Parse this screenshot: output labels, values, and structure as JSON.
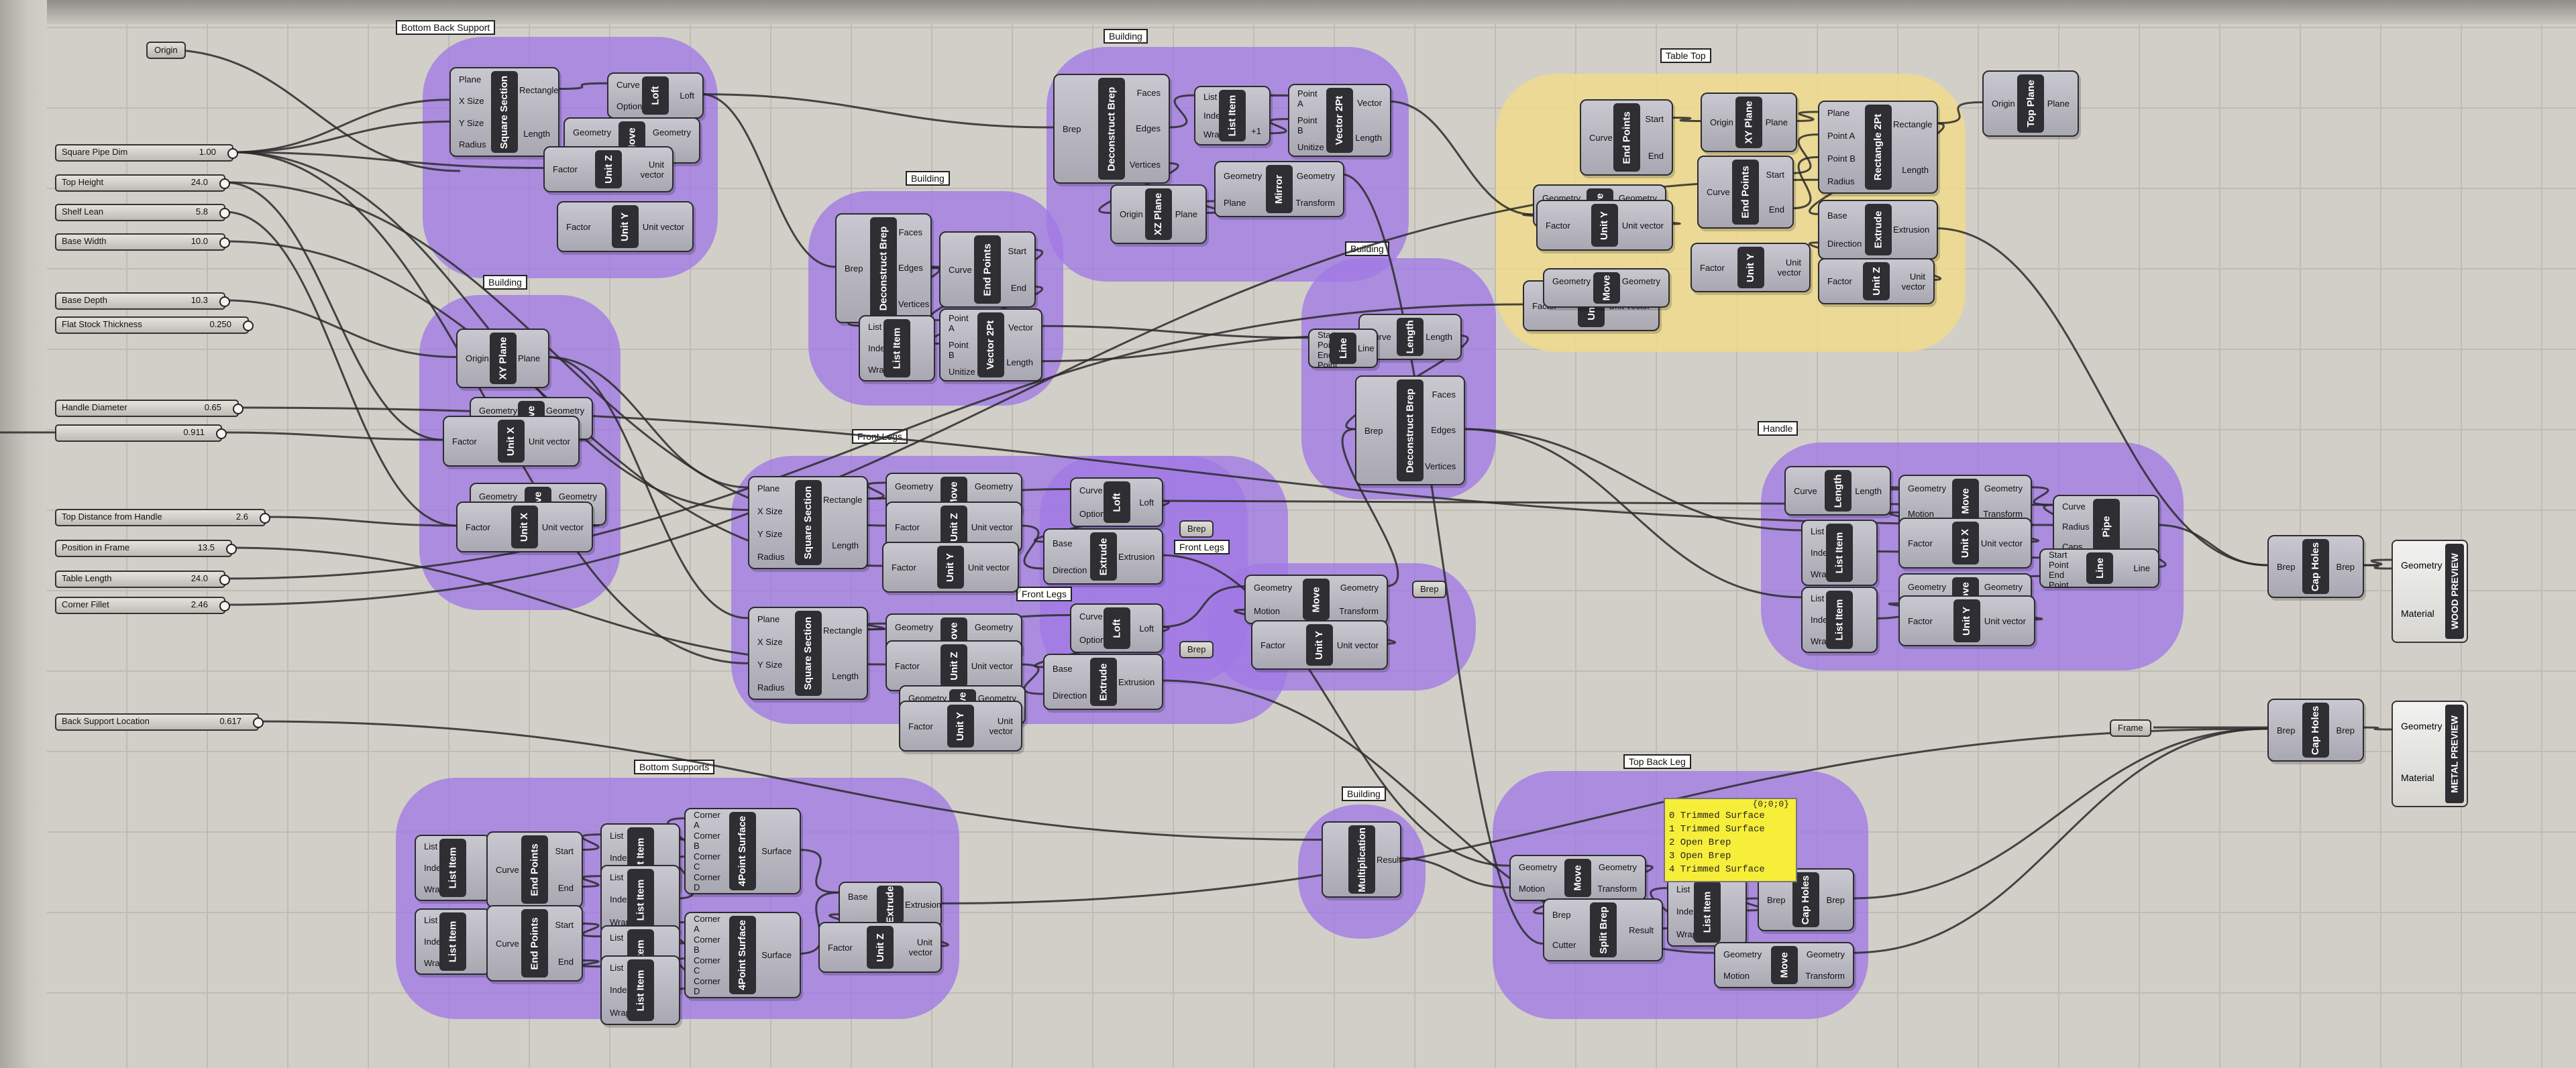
{
  "app": {
    "name": "Grasshopper canvas"
  },
  "groups": [
    {
      "id": "bottom-back-support",
      "label": "Bottom Back Support",
      "color": "purple"
    },
    {
      "id": "building-1",
      "label": "Building",
      "color": "purple"
    },
    {
      "id": "building-2",
      "label": "Building",
      "color": "purple"
    },
    {
      "id": "building-3",
      "label": "Building",
      "color": "purple"
    },
    {
      "id": "building-4",
      "label": "Building",
      "color": "purple"
    },
    {
      "id": "building-5",
      "label": "Building",
      "color": "purple"
    },
    {
      "id": "table-top",
      "label": "Table Top",
      "color": "yellow"
    },
    {
      "id": "front-legs-1",
      "label": "Front Legs",
      "color": "purple"
    },
    {
      "id": "front-legs-2",
      "label": "Front Legs",
      "color": "purple"
    },
    {
      "id": "front-legs-3",
      "label": "Front Legs",
      "color": "purple"
    },
    {
      "id": "bottom-supports",
      "label": "Bottom Supports",
      "color": "purple"
    },
    {
      "id": "handle",
      "label": "Handle",
      "color": "purple"
    },
    {
      "id": "top-back-leg",
      "label": "Top Back Leg",
      "color": "purple"
    }
  ],
  "params": {
    "origin": "Origin",
    "frame": "Frame",
    "brep1": "Brep",
    "brep2": "Brep",
    "brep3": "Brep"
  },
  "sliders": [
    {
      "id": "square-pipe-dim",
      "label": "Square Pipe Dim",
      "value": "1.00"
    },
    {
      "id": "top-height",
      "label": "Top Height",
      "value": "24.0"
    },
    {
      "id": "shelf-lean",
      "label": "Shelf Lean",
      "value": "5.8"
    },
    {
      "id": "base-width",
      "label": "Base Width",
      "value": "10.0"
    },
    {
      "id": "base-depth",
      "label": "Base Depth",
      "value": "10.3"
    },
    {
      "id": "flat-stock-thickness",
      "label": "Flat Stock Thickness",
      "value": "0.250"
    },
    {
      "id": "handle-diameter",
      "label": "Handle Diameter",
      "value": "0.65"
    },
    {
      "id": "unnamed",
      "label": "",
      "value": "0.911"
    },
    {
      "id": "top-distance-from-handle",
      "label": "Top Distance from Handle",
      "value": "2.6"
    },
    {
      "id": "position-in-frame",
      "label": "Position in Frame",
      "value": "13.5"
    },
    {
      "id": "table-length",
      "label": "Table Length",
      "value": "24.0"
    },
    {
      "id": "corner-fillet",
      "label": "Corner Fillet",
      "value": "2.46"
    },
    {
      "id": "back-support-location",
      "label": "Back Support Location",
      "value": "0.617"
    }
  ],
  "components": [
    {
      "id": "sqsec-1",
      "name": "Square Section",
      "inputs": [
        "Plane",
        "X Size",
        "Y Size",
        "Radius"
      ],
      "outputs": [
        "Rectangle",
        "Length"
      ]
    },
    {
      "id": "loft-1",
      "name": "Loft",
      "inputs": [
        "Curve",
        "Options"
      ],
      "outputs": [
        "Loft"
      ]
    },
    {
      "id": "move-1",
      "name": "Move",
      "inputs": [
        "Geometry",
        ""
      ],
      "outputs": [
        "Geometry",
        ""
      ]
    },
    {
      "id": "unitz-1",
      "name": "Unit Z",
      "inputs": [
        "Factor"
      ],
      "outputs": [
        "Unit vector"
      ]
    },
    {
      "id": "unity-1",
      "name": "Unit Y",
      "inputs": [
        "Factor"
      ],
      "outputs": [
        "Unit vector"
      ]
    },
    {
      "id": "dbrep-1",
      "name": "Deconstruct Brep",
      "inputs": [
        "Brep"
      ],
      "outputs": [
        "Faces",
        "Edges",
        "Vertices"
      ]
    },
    {
      "id": "listitem-1",
      "name": "List Item",
      "inputs": [
        "List",
        "Index",
        "Wrap"
      ],
      "outputs": [
        "",
        "",
        "+1"
      ]
    },
    {
      "id": "vector2pt-1",
      "name": "Vector 2Pt",
      "inputs": [
        "Point A",
        "Point B",
        "Unitize"
      ],
      "outputs": [
        "Vector",
        "Length"
      ]
    },
    {
      "id": "xzplane",
      "name": "XZ Plane",
      "inputs": [
        "Origin"
      ],
      "outputs": [
        "Plane"
      ]
    },
    {
      "id": "mirror",
      "name": "Mirror",
      "inputs": [
        "Geometry",
        "Plane"
      ],
      "outputs": [
        "Geometry",
        "Transform"
      ]
    },
    {
      "id": "dbrep-2",
      "name": "Deconstruct Brep",
      "inputs": [
        "Brep"
      ],
      "outputs": [
        "Faces",
        "Edges",
        "Vertices"
      ]
    },
    {
      "id": "endpoints-1",
      "name": "End Points",
      "inputs": [
        "Curve"
      ],
      "outputs": [
        "Start",
        "End"
      ]
    },
    {
      "id": "listitem-2",
      "name": "List Item",
      "inputs": [
        "List",
        "Index",
        "Wrap"
      ],
      "outputs": [
        ""
      ]
    },
    {
      "id": "vector2pt-2",
      "name": "Vector 2Pt",
      "inputs": [
        "Point A",
        "Point B",
        "Unitize"
      ],
      "outputs": [
        "Vector",
        "Length"
      ]
    },
    {
      "id": "xyplane-1",
      "name": "XY Plane",
      "inputs": [
        "Origin"
      ],
      "outputs": [
        "Plane"
      ]
    },
    {
      "id": "move-2",
      "name": "Move",
      "inputs": [
        "Geometry",
        ""
      ],
      "outputs": [
        "Geometry",
        ""
      ]
    },
    {
      "id": "unitx-1",
      "name": "Unit X",
      "inputs": [
        "Factor"
      ],
      "outputs": [
        "Unit vector"
      ]
    },
    {
      "id": "move-3",
      "name": "Move",
      "inputs": [
        "Geometry",
        ""
      ],
      "outputs": [
        "Geometry",
        ""
      ]
    },
    {
      "id": "unitx-2",
      "name": "Unit X",
      "inputs": [
        "Factor"
      ],
      "outputs": [
        "Unit vector"
      ]
    },
    {
      "id": "length-1",
      "name": "Length",
      "inputs": [
        "Curve"
      ],
      "outputs": [
        "Length"
      ]
    },
    {
      "id": "line-1",
      "name": "Line",
      "inputs": [
        "Start Point",
        "End Point"
      ],
      "outputs": [
        "Line"
      ]
    },
    {
      "id": "dbrep-3",
      "name": "Deconstruct Brep",
      "inputs": [
        "Brep"
      ],
      "outputs": [
        "Faces",
        "Edges",
        "Vertices"
      ]
    },
    {
      "id": "endpoints-2",
      "name": "End Points",
      "inputs": [
        "Curve"
      ],
      "outputs": [
        "Start",
        "End"
      ]
    },
    {
      "id": "xyplane-2",
      "name": "XY Plane",
      "inputs": [
        "Origin"
      ],
      "outputs": [
        "Plane"
      ]
    },
    {
      "id": "rect2pt",
      "name": "Rectangle 2Pt",
      "inputs": [
        "Plane",
        "Point A",
        "Point B",
        "Radius"
      ],
      "outputs": [
        "Rectangle",
        "Length"
      ]
    },
    {
      "id": "topplane",
      "name": "Top Plane",
      "inputs": [
        "Origin"
      ],
      "outputs": [
        "Plane"
      ]
    },
    {
      "id": "endpoints-3",
      "name": "End Points",
      "inputs": [
        "Curve"
      ],
      "outputs": [
        "Start",
        "End"
      ]
    },
    {
      "id": "move-4",
      "name": "Move",
      "inputs": [
        "Geometry",
        ""
      ],
      "outputs": [
        "Geometry",
        ""
      ]
    },
    {
      "id": "unity-2",
      "name": "Unit Y",
      "inputs": [
        "Factor"
      ],
      "outputs": [
        "Unit vector"
      ]
    },
    {
      "id": "extrude-1",
      "name": "Extrude",
      "inputs": [
        "Base",
        "Direction"
      ],
      "outputs": [
        "Extrusion"
      ]
    },
    {
      "id": "unity-3",
      "name": "Unit Y",
      "inputs": [
        "Factor"
      ],
      "outputs": [
        "Unit vector"
      ]
    },
    {
      "id": "unitz-2",
      "name": "Unit Z",
      "inputs": [
        "Factor"
      ],
      "outputs": [
        "Unit vector"
      ]
    },
    {
      "id": "move-5",
      "name": "Move",
      "inputs": [
        "Geometry",
        ""
      ],
      "outputs": [
        "Geometry",
        ""
      ]
    },
    {
      "id": "unitz-3",
      "name": "Unit Z",
      "inputs": [
        "Factor"
      ],
      "outputs": [
        "Unit vector"
      ]
    },
    {
      "id": "sqsec-2",
      "name": "Square Section",
      "inputs": [
        "Plane",
        "X Size",
        "Y Size",
        "Radius"
      ],
      "outputs": [
        "Rectangle",
        "Length"
      ]
    },
    {
      "id": "move-6",
      "name": "Move",
      "inputs": [
        "Geometry",
        ""
      ],
      "outputs": [
        "Geometry",
        ""
      ]
    },
    {
      "id": "unitz-4",
      "name": "Unit Z",
      "inputs": [
        "Factor"
      ],
      "outputs": [
        "Unit vector"
      ]
    },
    {
      "id": "loft-2",
      "name": "Loft",
      "inputs": [
        "Curve",
        "Options"
      ],
      "outputs": [
        "Loft"
      ]
    },
    {
      "id": "extrude-2",
      "name": "Extrude",
      "inputs": [
        "Base",
        "Direction"
      ],
      "outputs": [
        "Extrusion"
      ]
    },
    {
      "id": "unity-4",
      "name": "Unit Y",
      "inputs": [
        "Factor"
      ],
      "outputs": [
        "Unit vector"
      ]
    },
    {
      "id": "sqsec-3",
      "name": "Square Section",
      "inputs": [
        "Plane",
        "X Size",
        "Y Size",
        "Radius"
      ],
      "outputs": [
        "Rectangle",
        "Length"
      ]
    },
    {
      "id": "move-7",
      "name": "Move",
      "inputs": [
        "Geometry",
        ""
      ],
      "outputs": [
        "Geometry",
        ""
      ]
    },
    {
      "id": "unitz-5",
      "name": "Unit Z",
      "inputs": [
        "Factor"
      ],
      "outputs": [
        "Unit vector"
      ]
    },
    {
      "id": "loft-3",
      "name": "Loft",
      "inputs": [
        "Curve",
        "Options"
      ],
      "outputs": [
        "Loft"
      ]
    },
    {
      "id": "extrude-3",
      "name": "Extrude",
      "inputs": [
        "Base",
        "Direction"
      ],
      "outputs": [
        "Extrusion"
      ]
    },
    {
      "id": "move-8",
      "name": "Move",
      "inputs": [
        "Geometry",
        ""
      ],
      "outputs": [
        "Geometry",
        ""
      ]
    },
    {
      "id": "unity-5",
      "name": "Unit Y",
      "inputs": [
        "Factor"
      ],
      "outputs": [
        "Unit vector"
      ]
    },
    {
      "id": "move-9",
      "name": "Move",
      "inputs": [
        "Geometry",
        "Motion"
      ],
      "outputs": [
        "Geometry",
        "Transform"
      ]
    },
    {
      "id": "unity-6",
      "name": "Unit Y",
      "inputs": [
        "Factor"
      ],
      "outputs": [
        "Unit vector"
      ]
    },
    {
      "id": "length-2",
      "name": "Length",
      "inputs": [
        "Curve"
      ],
      "outputs": [
        "Length"
      ]
    },
    {
      "id": "move-10",
      "name": "Move",
      "inputs": [
        "Geometry",
        "Motion"
      ],
      "outputs": [
        "Geometry",
        "Transform"
      ]
    },
    {
      "id": "pipe",
      "name": "Pipe",
      "inputs": [
        "Curve",
        "Radius",
        "Caps"
      ],
      "outputs": [
        ""
      ]
    },
    {
      "id": "listitem-3",
      "name": "List Item",
      "inputs": [
        "List",
        "Index",
        "Wrap"
      ],
      "outputs": [
        ""
      ]
    },
    {
      "id": "unitx-3",
      "name": "Unit X",
      "inputs": [
        "Factor"
      ],
      "outputs": [
        "Unit vector"
      ]
    },
    {
      "id": "line-2",
      "name": "Line",
      "inputs": [
        "Start Point",
        "End Point"
      ],
      "outputs": [
        "Line"
      ]
    },
    {
      "id": "move-11",
      "name": "Move",
      "inputs": [
        "Geometry",
        ""
      ],
      "outputs": [
        "Geometry",
        ""
      ]
    },
    {
      "id": "listitem-4",
      "name": "List Item",
      "inputs": [
        "List",
        "Index",
        "Wrap"
      ],
      "outputs": [
        ""
      ]
    },
    {
      "id": "unity-7",
      "name": "Unit Y",
      "inputs": [
        "Factor"
      ],
      "outputs": [
        "Unit vector"
      ]
    },
    {
      "id": "capholes-1",
      "name": "Cap Holes",
      "inputs": [
        "Brep"
      ],
      "outputs": [
        "Brep"
      ]
    },
    {
      "id": "capholes-2",
      "name": "Cap Holes",
      "inputs": [
        "Brep"
      ],
      "outputs": [
        "Brep"
      ]
    },
    {
      "id": "listitem-5",
      "name": "List Item",
      "inputs": [
        "List",
        "Index",
        "Wrap"
      ],
      "outputs": [
        ""
      ]
    },
    {
      "id": "endpoints-4",
      "name": "End Points",
      "inputs": [
        "Curve"
      ],
      "outputs": [
        "Start",
        "End"
      ]
    },
    {
      "id": "listitem-6",
      "name": "List Item",
      "inputs": [
        "List",
        "Index",
        "Wrap"
      ],
      "outputs": [
        ""
      ]
    },
    {
      "id": "endpoints-5",
      "name": "End Points",
      "inputs": [
        "Curve"
      ],
      "outputs": [
        "Start",
        "End"
      ]
    },
    {
      "id": "listitem-7",
      "name": "List Item",
      "inputs": [
        "List",
        "Index",
        "Wrap"
      ],
      "outputs": [
        ""
      ]
    },
    {
      "id": "listitem-8",
      "name": "List Item",
      "inputs": [
        "List",
        "Index",
        "Wrap"
      ],
      "outputs": [
        ""
      ]
    },
    {
      "id": "listitem-9",
      "name": "List Item",
      "inputs": [
        "List",
        "Index",
        "Wrap"
      ],
      "outputs": [
        ""
      ]
    },
    {
      "id": "listitem-10",
      "name": "List Item",
      "inputs": [
        "List",
        "Index",
        "Wrap"
      ],
      "outputs": [
        ""
      ]
    },
    {
      "id": "4ptsurf-1",
      "name": "4Point Surface",
      "inputs": [
        "Corner A",
        "Corner B",
        "Corner C",
        "Corner D"
      ],
      "outputs": [
        "Surface"
      ]
    },
    {
      "id": "4ptsurf-2",
      "name": "4Point Surface",
      "inputs": [
        "Corner A",
        "Corner B",
        "Corner C",
        "Corner D"
      ],
      "outputs": [
        "Surface"
      ]
    },
    {
      "id": "extrude-4",
      "name": "Extrude",
      "inputs": [
        "Base",
        ""
      ],
      "outputs": [
        "Extrusion"
      ]
    },
    {
      "id": "unitz-6",
      "name": "Unit Z",
      "inputs": [
        "Factor"
      ],
      "outputs": [
        "Unit vector"
      ]
    },
    {
      "id": "multiplication",
      "name": "Multiplication",
      "inputs": [
        "",
        ""
      ],
      "outputs": [
        "Result"
      ]
    },
    {
      "id": "move-12",
      "name": "Move",
      "inputs": [
        "Geometry",
        "Motion"
      ],
      "outputs": [
        "Geometry",
        "Transform"
      ]
    },
    {
      "id": "splitbrep",
      "name": "Split Brep",
      "inputs": [
        "Brep",
        "Cutter"
      ],
      "outputs": [
        "Result"
      ]
    },
    {
      "id": "listitem-11",
      "name": "List Item",
      "inputs": [
        "List",
        "Index",
        "Wrap"
      ],
      "outputs": [
        ""
      ]
    },
    {
      "id": "capholes-3",
      "name": "Cap Holes",
      "inputs": [
        "Brep"
      ],
      "outputs": [
        "Brep"
      ]
    },
    {
      "id": "move-13",
      "name": "Move",
      "inputs": [
        "Geometry",
        "Motion"
      ],
      "outputs": [
        "Geometry",
        "Transform"
      ]
    },
    {
      "id": "capholes-4",
      "name": "Cap Holes",
      "inputs": [
        "Brep"
      ],
      "outputs": [
        "Brep"
      ]
    },
    {
      "id": "capholes-5",
      "name": "Cap Holes",
      "inputs": [
        "Brep"
      ],
      "outputs": [
        "Brep"
      ]
    }
  ],
  "panel": {
    "header": "{0;0;0}",
    "lines": [
      "0 Trimmed Surface",
      "1 Trimmed Surface",
      "2 Open Brep",
      "3 Open Brep",
      "4 Trimmed Surface"
    ]
  },
  "previews": [
    {
      "id": "wood-preview",
      "name": "WOOD PREVIEW",
      "inputs": [
        "Geometry",
        "Material"
      ]
    },
    {
      "id": "metal-preview",
      "name": "METAL PREVIEW",
      "inputs": [
        "Geometry",
        "Material"
      ]
    }
  ],
  "colors": {
    "canvas": "#d2cfc8",
    "group_purple": "#a078e6",
    "group_yellow": "#f0da8c",
    "panel": "#f7ee3a",
    "wire": "#2a2a2a"
  }
}
